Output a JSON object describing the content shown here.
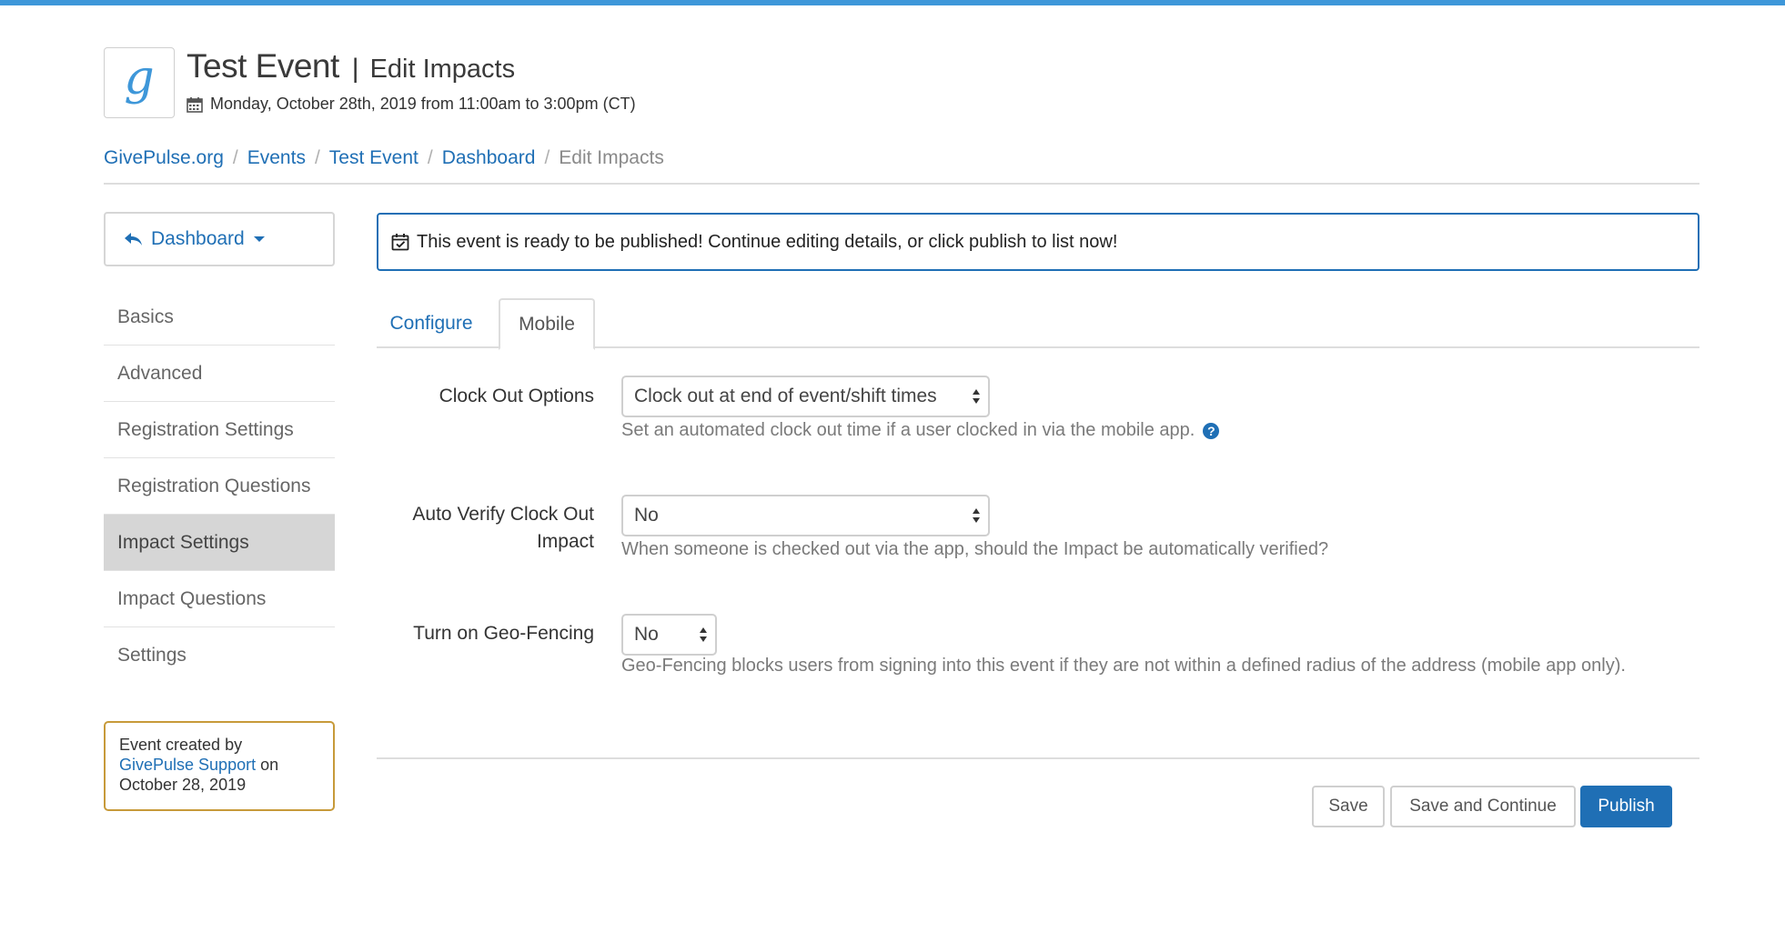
{
  "header": {
    "logo_letter": "g",
    "title": "Test Event",
    "separator": "|",
    "subtitle": "Edit Impacts",
    "date": "Monday, October 28th, 2019 from 11:00am to 3:00pm (CT)"
  },
  "breadcrumb": {
    "items": [
      "GivePulse.org",
      "Events",
      "Test Event",
      "Dashboard"
    ],
    "current": "Edit Impacts",
    "separator": "/"
  },
  "sidebar": {
    "dashboard_button": "Dashboard",
    "items": [
      {
        "label": "Basics"
      },
      {
        "label": "Advanced"
      },
      {
        "label": "Registration Settings"
      },
      {
        "label": "Registration Questions"
      },
      {
        "label": "Impact Settings",
        "active": true
      },
      {
        "label": "Impact Questions"
      },
      {
        "label": "Settings"
      }
    ],
    "created": {
      "prefix": "Event created by",
      "author": "GivePulse Support",
      "on": "on",
      "date": "October 28, 2019"
    }
  },
  "alert": {
    "text": "This event is ready to be published! Continue editing details, or click publish to list now!"
  },
  "tabs": [
    {
      "label": "Configure",
      "active": false
    },
    {
      "label": "Mobile",
      "active": true
    }
  ],
  "form": {
    "clock_out": {
      "label": "Clock Out Options",
      "value": "Clock out at end of event/shift times",
      "help": "Set an automated clock out time if a user clocked in via the mobile app.",
      "help_icon": "?"
    },
    "auto_verify": {
      "label_line1": "Auto Verify Clock Out",
      "label_line2": "Impact",
      "value": "No",
      "help": "When someone is checked out via the app, should the Impact be automatically verified?"
    },
    "geo_fencing": {
      "label": "Turn on Geo-Fencing",
      "value": "No",
      "help": "Geo-Fencing blocks users from signing into this event if they are not within a defined radius of the address (mobile app only)."
    }
  },
  "actions": {
    "save": "Save",
    "save_continue": "Save and Continue",
    "publish": "Publish"
  },
  "colors": {
    "accent": "#1f6fb5",
    "topbar": "#3e97d9",
    "created_border": "#c79a3a",
    "active_nav_bg": "#d6d6d6"
  }
}
